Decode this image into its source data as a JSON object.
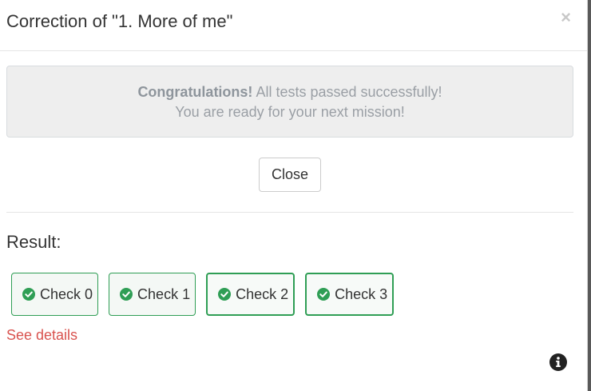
{
  "modal": {
    "title": "Correction of \"1. More of me\"",
    "close_symbol": "×"
  },
  "alert": {
    "strong": "Congratulations!",
    "line1_rest": " All tests passed successfully!",
    "line2": "You are ready for your next mission!"
  },
  "actions": {
    "close_label": "Close"
  },
  "result": {
    "heading": "Result:",
    "checks": [
      {
        "label": "Check 0",
        "status": "passed",
        "icon": "check-circle-icon"
      },
      {
        "label": "Check 1",
        "status": "passed",
        "icon": "check-circle-icon"
      },
      {
        "label": "Check 2",
        "status": "passed",
        "icon": "check-circle-icon"
      },
      {
        "label": "Check 3",
        "status": "passed",
        "icon": "check-circle-icon"
      }
    ],
    "details_link": "See details"
  },
  "colors": {
    "success": "#2f9e55",
    "danger": "#d9534f",
    "alert_bg": "#eeeeee"
  },
  "icons": {
    "info": "info-circle-icon"
  }
}
